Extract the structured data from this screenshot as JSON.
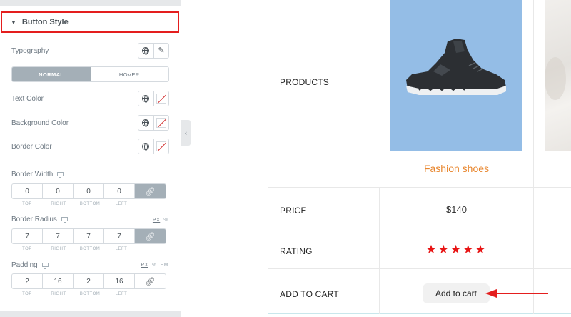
{
  "panel": {
    "section_title": "Button Style",
    "typography_label": "Typography",
    "tabs": [
      "NORMAL",
      "HOVER"
    ],
    "text_color_label": "Text Color",
    "background_color_label": "Background Color",
    "border_color_label": "Border Color",
    "border_width": {
      "label": "Border Width",
      "values": [
        "0",
        "0",
        "0",
        "0"
      ],
      "sides": [
        "TOP",
        "RIGHT",
        "BOTTOM",
        "LEFT"
      ]
    },
    "border_radius": {
      "label": "Border Radius",
      "values": [
        "7",
        "7",
        "7",
        "7"
      ],
      "sides": [
        "TOP",
        "RIGHT",
        "BOTTOM",
        "LEFT"
      ],
      "units": [
        "PX",
        "%"
      ]
    },
    "padding": {
      "label": "Padding",
      "values": [
        "2",
        "16",
        "2",
        "16"
      ],
      "sides": [
        "TOP",
        "RIGHT",
        "BOTTOM",
        "LEFT"
      ],
      "units": [
        "PX",
        "%",
        "EM"
      ]
    }
  },
  "table": {
    "rows": [
      "PRODUCTS",
      "PRICE",
      "RATING",
      "ADD TO CART"
    ],
    "product_name": "Fashion shoes",
    "price": "$140",
    "rating": 5,
    "rating_display": "★★★★★",
    "button_label": "Add to cart"
  },
  "colors": {
    "highlight": "#e41e1e",
    "product_name": "#e8862e",
    "stars": "#e81414",
    "product_bg": "#94bde6"
  }
}
